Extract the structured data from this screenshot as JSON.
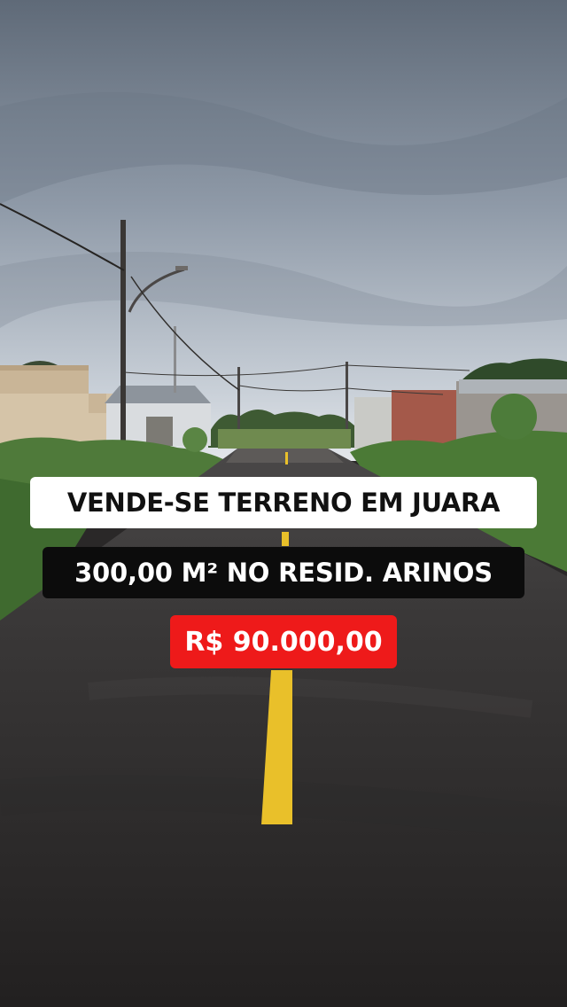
{
  "listing": {
    "headline": "VENDE-SE TERRENO EM JUARA",
    "details": "300,00 M² NO RESID. ARINOS",
    "price": "R$ 90.000,00"
  },
  "colors": {
    "headline_bg": "#ffffff",
    "details_bg": "#0c0c0c",
    "price_bg": "#ee1a1a",
    "road_line": "#e9c02a"
  }
}
